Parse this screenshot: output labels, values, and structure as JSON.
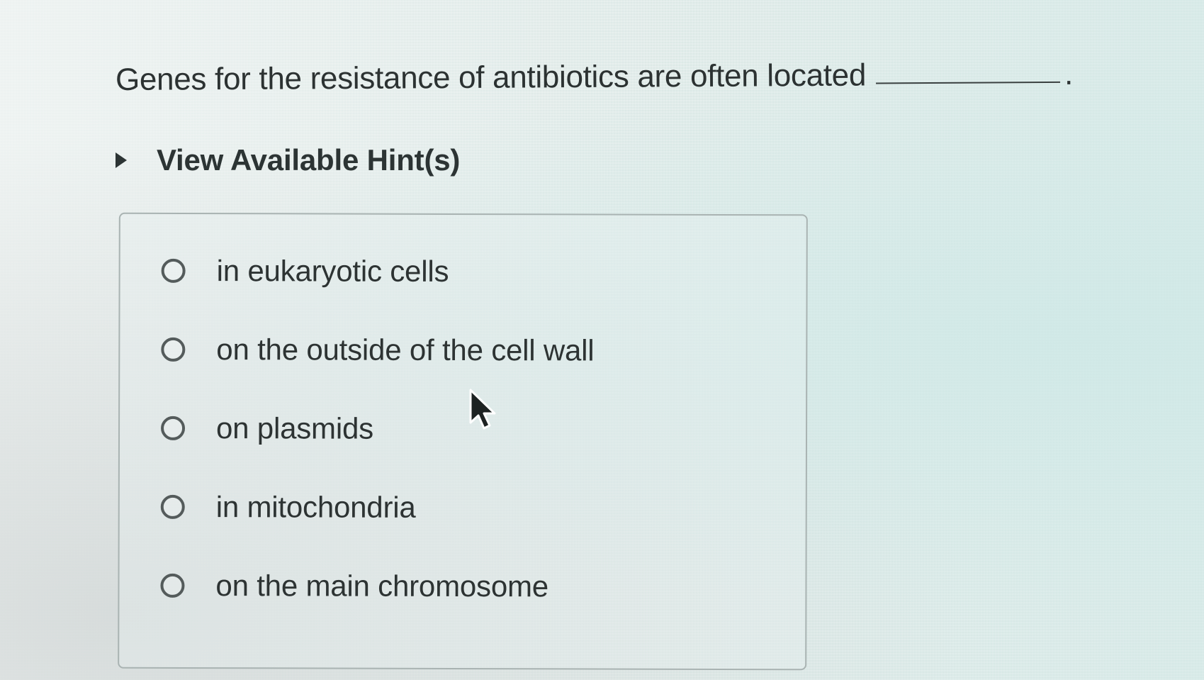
{
  "question": {
    "text": "Genes for the resistance of antibiotics are often located",
    "end_mark": "."
  },
  "hint": {
    "label": "View Available Hint(s)",
    "icon": "caret-right-icon"
  },
  "options": [
    {
      "label": "in eukaryotic cells",
      "selected": false
    },
    {
      "label": "on the outside of the cell wall",
      "selected": false
    },
    {
      "label": "on plasmids",
      "selected": false
    },
    {
      "label": "in mitochondria",
      "selected": false
    },
    {
      "label": "on the main chromosome",
      "selected": false
    }
  ],
  "cursor": {
    "icon": "mouse-pointer-icon"
  }
}
